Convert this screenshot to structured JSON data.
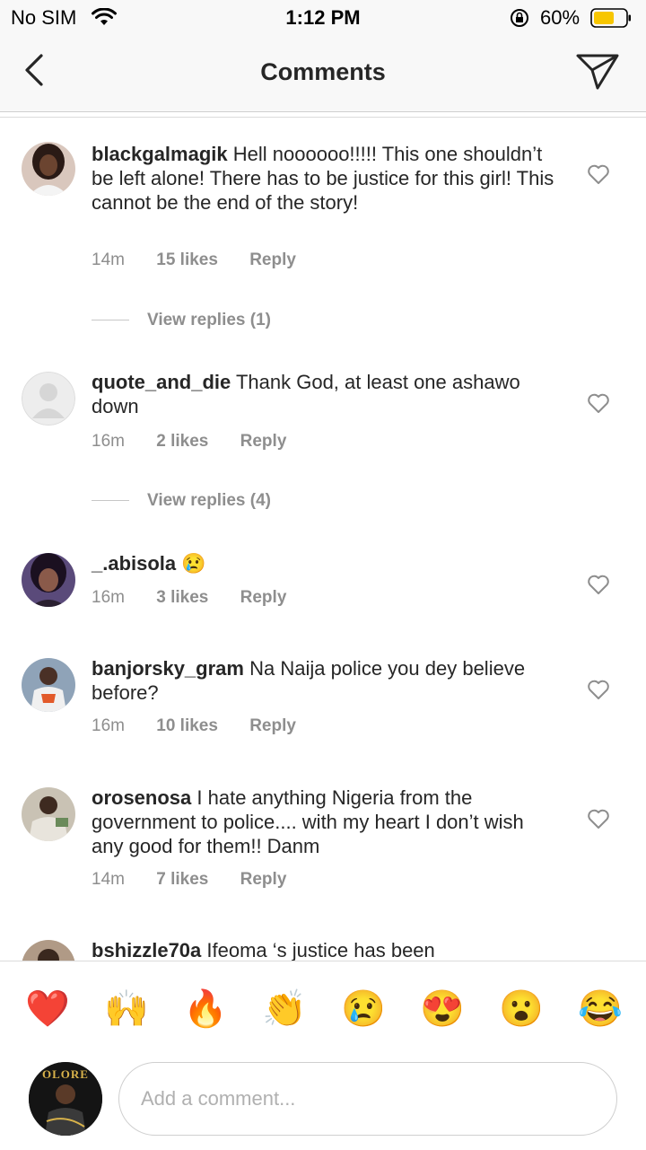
{
  "status_bar": {
    "carrier": "No SIM",
    "time": "1:12 PM",
    "battery": "60%"
  },
  "header": {
    "title": "Comments",
    "back_icon": "chevron-left-icon",
    "share_icon": "paper-plane-icon"
  },
  "comments": [
    {
      "username": "blackgalmagik",
      "text": "Hell noooooo!!!!! This one shouldn’t be left alone! There has to be justice for this girl! This cannot be the end of the story!",
      "time": "14m",
      "likes": "15 likes",
      "reply": "Reply",
      "view_replies": "View replies (1)"
    },
    {
      "username": "quote_and_die",
      "text": "Thank God, at least one ashawo down",
      "time": "16m",
      "likes": "2 likes",
      "reply": "Reply",
      "view_replies": "View replies (4)"
    },
    {
      "username": "_.abisola",
      "text": "😢",
      "time": "16m",
      "likes": "3 likes",
      "reply": "Reply"
    },
    {
      "username": "banjorsky_gram",
      "text": "Na Naija police you dey believe before?",
      "time": "16m",
      "likes": "10 likes",
      "reply": "Reply"
    },
    {
      "username": "orosenosa",
      "text": "I hate anything Nigeria from the government to police.... with my heart I don’t wish any good for them!! Danm",
      "time": "14m",
      "likes": "7 likes",
      "reply": "Reply"
    },
    {
      "username": "bshizzle70a",
      "text": "Ifeoma ‘s justice has been"
    }
  ],
  "quick_reactions": [
    "❤️",
    "🙌",
    "🔥",
    "👏",
    "😢",
    "😍",
    "😮",
    "😂"
  ],
  "composer": {
    "placeholder": "Add a comment...",
    "avatar_text": "OLORE"
  }
}
